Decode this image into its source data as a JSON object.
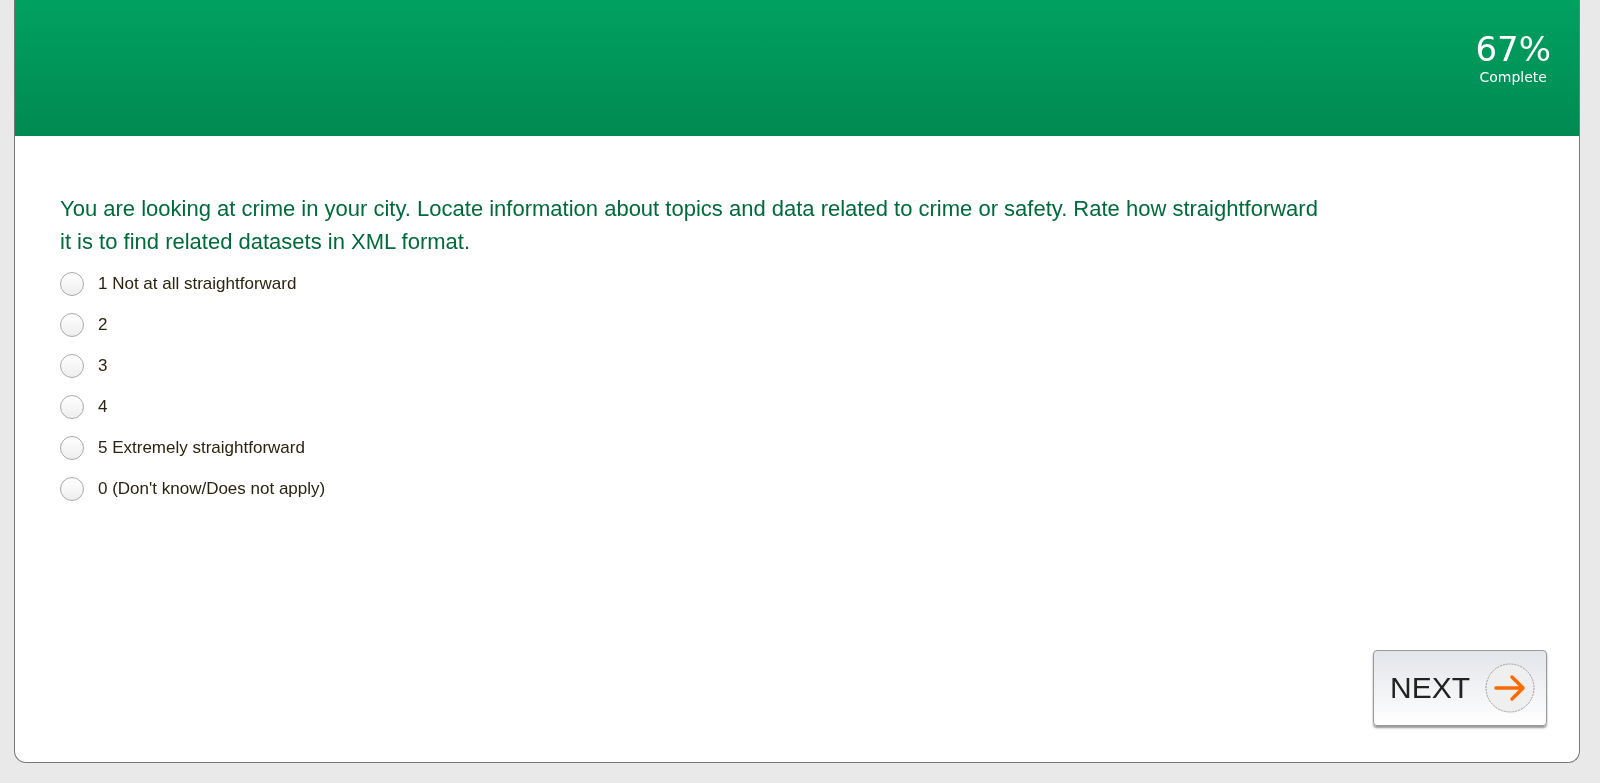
{
  "progress": {
    "percent": "67%",
    "label": "Complete"
  },
  "question": "You are looking at crime in your city. Locate information about topics and data related to crime or safety. Rate how straightforward it is to find related datasets in XML format.",
  "options": [
    {
      "label": "1 Not at all straightforward",
      "selected": false
    },
    {
      "label": "2",
      "selected": false
    },
    {
      "label": "3",
      "selected": false
    },
    {
      "label": "4",
      "selected": false
    },
    {
      "label": "5 Extremely straightforward",
      "selected": false
    },
    {
      "label": "0 (Don't know/Does not apply)",
      "selected": false
    }
  ],
  "next_button": {
    "label": "NEXT"
  }
}
